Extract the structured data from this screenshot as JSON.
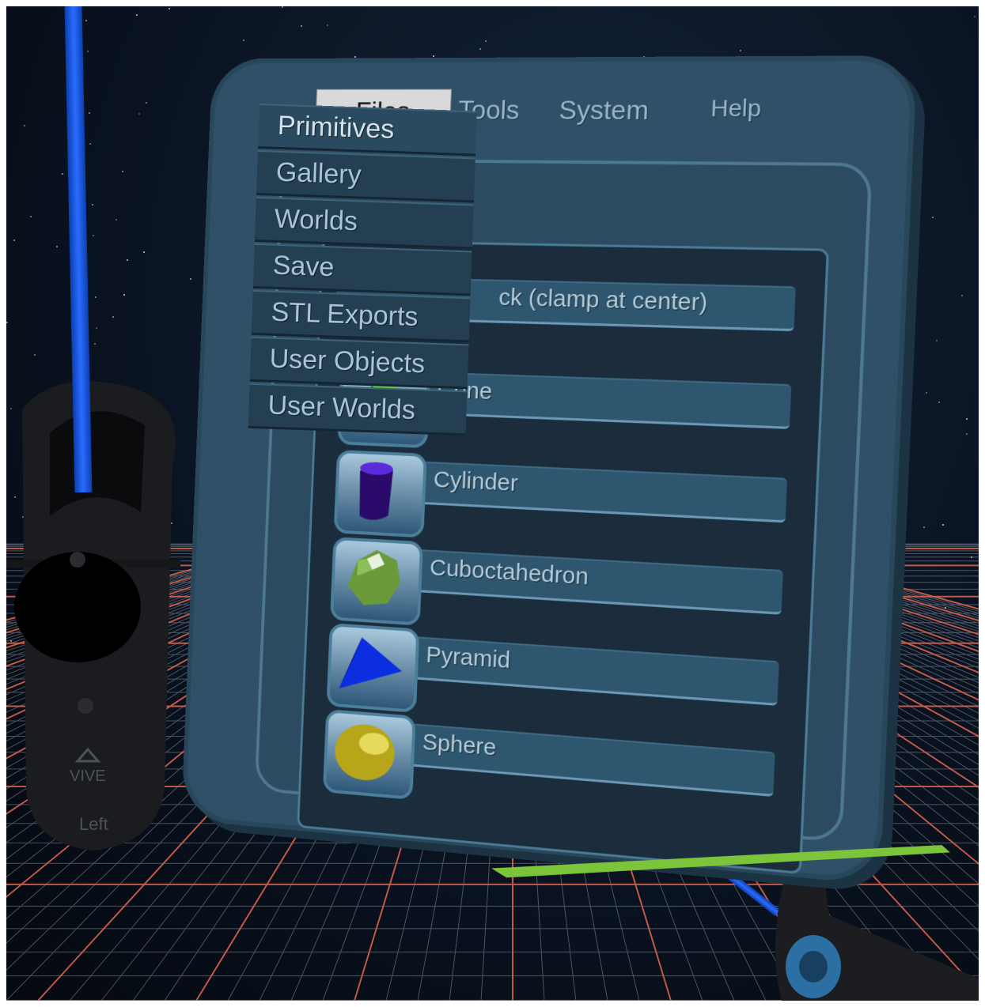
{
  "menubar": {
    "files": "Files",
    "tools": "Tools",
    "system": "System",
    "help": "Help"
  },
  "files_menu": {
    "items": [
      "Primitives",
      "Gallery",
      "Worlds",
      "Save",
      "STL Exports",
      "User Objects",
      "User Worlds"
    ]
  },
  "list": {
    "partial_label": "ck (clamp at center)",
    "items": [
      {
        "label": "Cone",
        "icon": "cone-icon"
      },
      {
        "label": "Cylinder",
        "icon": "cylinder-icon"
      },
      {
        "label": "Cuboctahedron",
        "icon": "cuboctahedron-icon"
      },
      {
        "label": "Pyramid",
        "icon": "pyramid-icon"
      },
      {
        "label": "Sphere",
        "icon": "sphere-icon"
      }
    ]
  },
  "controller": {
    "brand": "VIVE",
    "side": "Left"
  },
  "colors": {
    "panel": "#2f5066",
    "ray": "#2a6cff",
    "grid_line": "#d9604a",
    "accent_green": "#7cc43a"
  }
}
